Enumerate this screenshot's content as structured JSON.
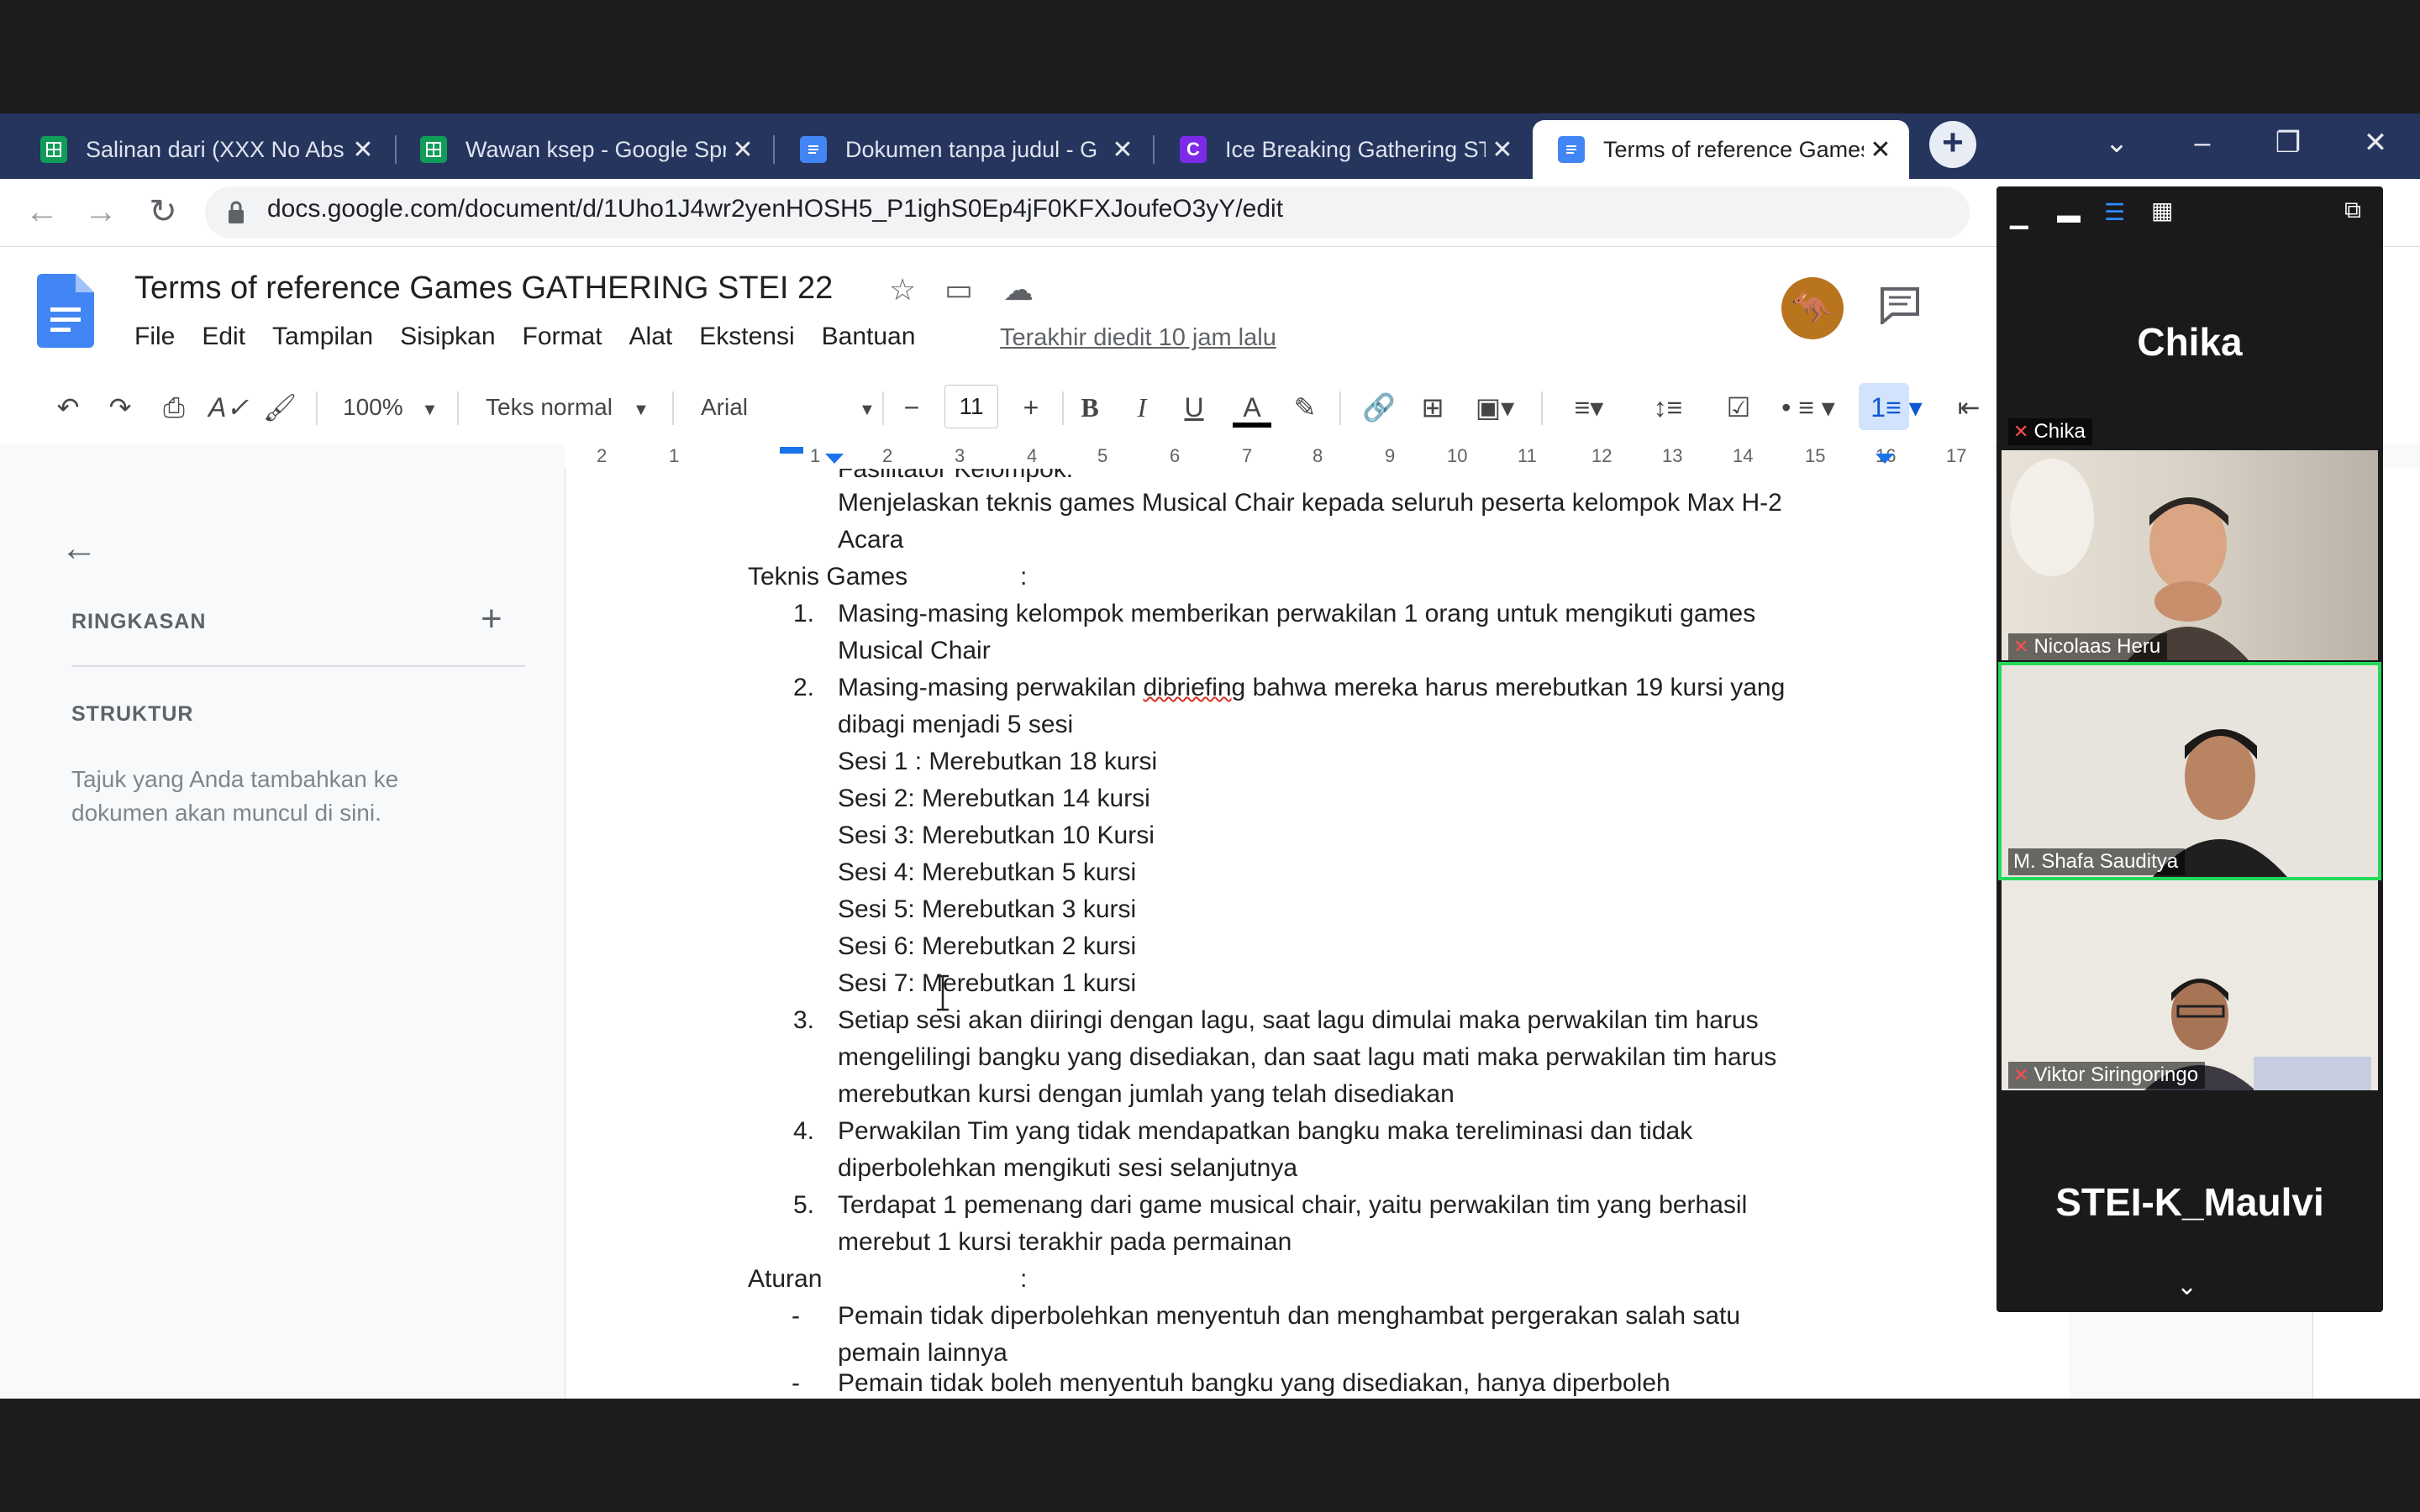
{
  "browser": {
    "tabs": [
      {
        "label": "Salinan dari (XXX No Abs",
        "icon": "sheets-icon"
      },
      {
        "label": "Wawan ksep - Google Spr",
        "icon": "sheets-icon"
      },
      {
        "label": "Dokumen tanpa judul - G",
        "icon": "docs-icon"
      },
      {
        "label": "Ice Breaking Gathering ST",
        "icon": "canva-icon"
      },
      {
        "label": "Terms of reference Games",
        "icon": "docs-icon",
        "active": true
      }
    ],
    "url": "docs.google.com/document/d/1Uho1J4wr2yenHOSH5_P1ighS0Ep4jF0KFXJoufeO3yY/edit"
  },
  "docs": {
    "title": "Terms of reference Games GATHERING STEI 22",
    "menu": [
      "File",
      "Edit",
      "Tampilan",
      "Sisipkan",
      "Format",
      "Alat",
      "Ekstensi",
      "Bantuan"
    ],
    "last_edit": "Terakhir diedit 10 jam lalu",
    "toolbar": {
      "zoom": "100%",
      "style": "Teks normal",
      "font": "Arial",
      "font_size": "11"
    },
    "ruler_marks": [
      "2",
      "1",
      "1",
      "2",
      "3",
      "4",
      "5",
      "6",
      "7",
      "8",
      "9",
      "10",
      "11",
      "12",
      "13",
      "14",
      "15",
      "16",
      "17"
    ],
    "outline": {
      "summary_label": "RINGKASAN",
      "structure_label": "STRUKTUR",
      "structure_hint": "Tajuk yang Anda tambahkan ke dokumen akan muncul di sini."
    },
    "body": {
      "l0": "Fasilitator Kelompok:",
      "l1": "Menjelaskan teknis games Musical Chair kepada seluruh peserta kelompok Max H-2",
      "l2": "Acara",
      "teknis_label": "Teknis Games",
      "colon": ":",
      "n1": "1.",
      "n1a": "Masing-masing kelompok memberikan perwakilan 1 orang untuk mengikuti games",
      "n1b": "Musical Chair",
      "n2": "2.",
      "n2a_pre": "Masing-masing perwakilan ",
      "n2a_mis": "dibriefing",
      "n2a_post": " bahwa mereka harus merebutkan 19 kursi yang",
      "n2b": "dibagi menjadi 5 sesi",
      "sesi": [
        "Sesi 1 : Merebutkan 18 kursi",
        "Sesi 2: Merebutkan 14 kursi",
        "Sesi 3: Merebutkan 10 Kursi",
        "Sesi 4: Merebutkan 5 kursi",
        "Sesi 5: Merebutkan 3 kursi",
        "Sesi 6: Merebutkan 2 kursi",
        "Sesi 7: Merebutkan 1 kursi"
      ],
      "n3": "3.",
      "n3a": " Setiap sesi akan diiringi dengan lagu, saat lagu dimulai maka perwakilan tim harus",
      "n3b": "mengelilingi bangku yang disediakan, dan saat lagu mati maka perwakilan tim harus",
      "n3c": "merebutkan kursi dengan jumlah yang telah disediakan",
      "n4": "4.",
      "n4a": "Perwakilan Tim yang tidak mendapatkan bangku maka tereliminasi dan tidak",
      "n4b": "diperbolehkan mengikuti sesi selanjutnya",
      "n5": "5.",
      "n5a": "Terdapat 1 pemenang dari game musical chair, yaitu perwakilan tim yang berhasil",
      "n5b": "merebut 1 kursi terakhir pada permainan",
      "aturan_label": "Aturan",
      "dash": "-",
      "r1a": "Pemain tidak diperbolehkan menyentuh dan menghambat pergerakan salah satu",
      "r1b": "pemain lainnya",
      "r2a": "Pemain tidak boleh menyentuh bangku yang disediakan, hanya diperboleh"
    }
  },
  "zoom": {
    "participants": [
      {
        "name": "Chika",
        "muted": true,
        "video": false
      },
      {
        "name": "Nicolaas Heru",
        "muted": true,
        "video": true
      },
      {
        "name": "M. Shafa Sauditya",
        "muted": false,
        "video": true
      },
      {
        "name": "Viktor Siringoringo",
        "muted": true,
        "video": true
      },
      {
        "name": "STEI-K_Maulvi",
        "muted": true,
        "video": false
      }
    ]
  }
}
